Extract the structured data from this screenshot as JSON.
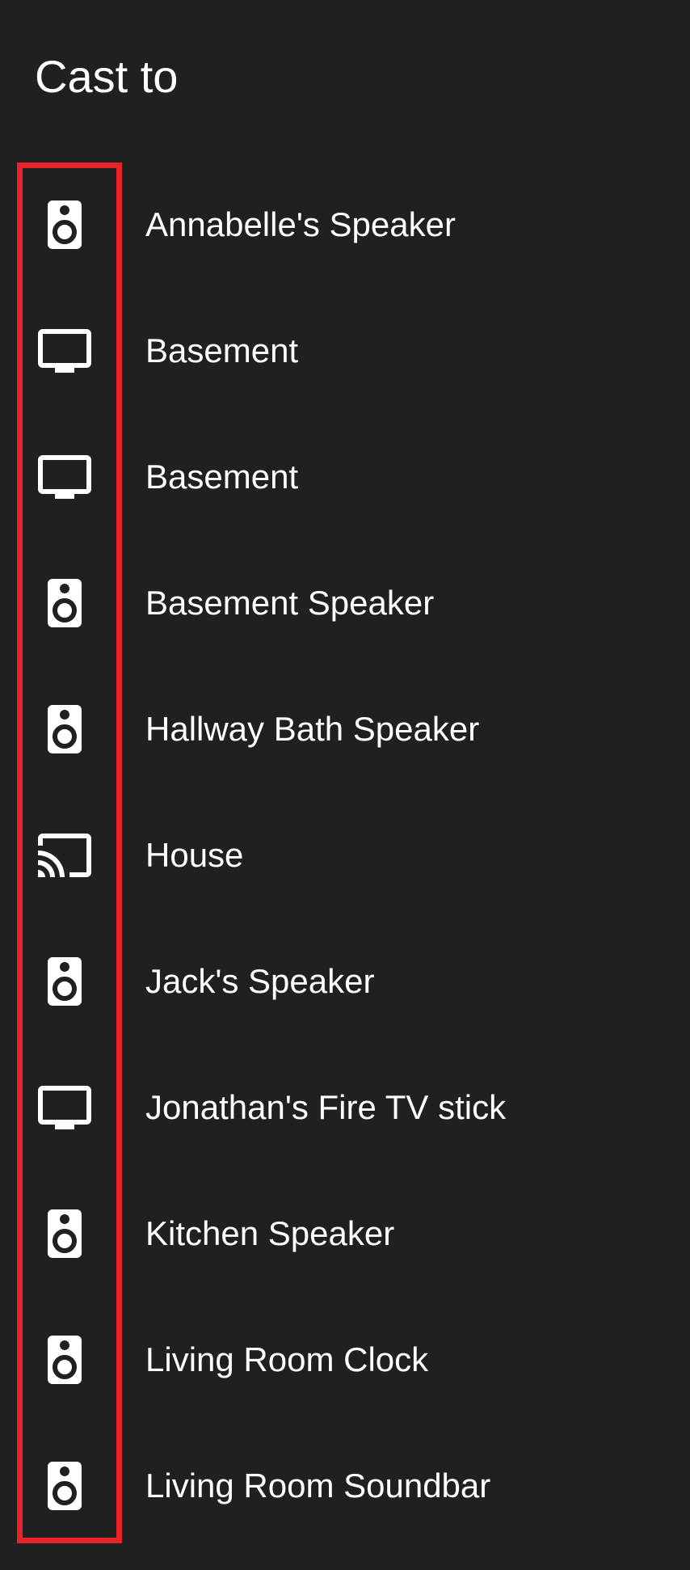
{
  "dialog": {
    "title": "Cast to"
  },
  "devices": [
    {
      "name": "Annabelle's Speaker",
      "icon": "speaker-icon"
    },
    {
      "name": "Basement",
      "icon": "tv-icon"
    },
    {
      "name": "Basement",
      "icon": "tv-icon"
    },
    {
      "name": "Basement Speaker",
      "icon": "speaker-icon"
    },
    {
      "name": "Hallway Bath Speaker",
      "icon": "speaker-icon"
    },
    {
      "name": "House",
      "icon": "cast-icon"
    },
    {
      "name": "Jack's Speaker",
      "icon": "speaker-icon"
    },
    {
      "name": "Jonathan's Fire TV stick",
      "icon": "tv-icon"
    },
    {
      "name": "Kitchen Speaker",
      "icon": "speaker-icon"
    },
    {
      "name": "Living Room Clock",
      "icon": "speaker-icon"
    },
    {
      "name": "Living Room Soundbar",
      "icon": "speaker-icon"
    }
  ],
  "colors": {
    "background": "#202020",
    "text": "#ffffff",
    "highlight": "#e8232a"
  }
}
